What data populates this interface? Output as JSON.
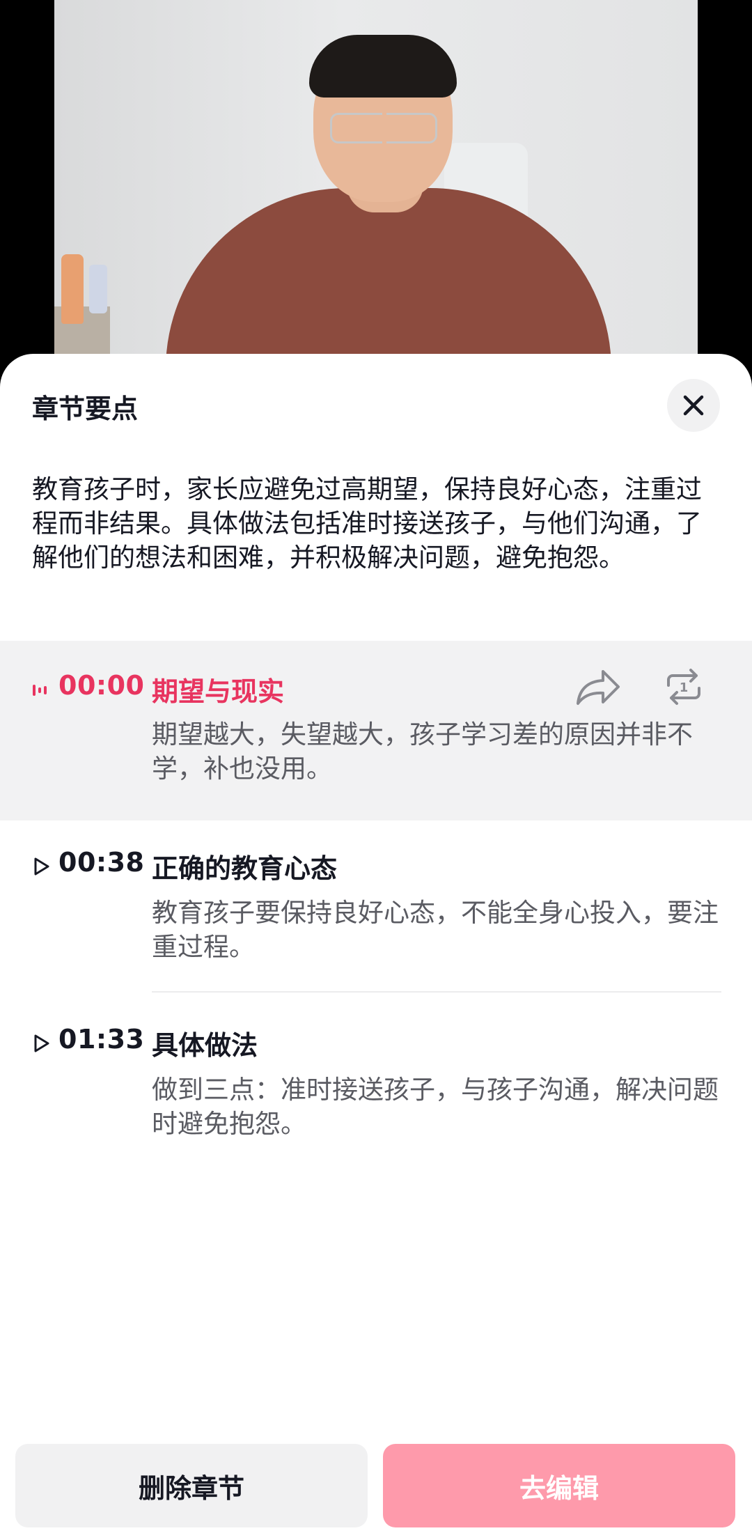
{
  "sheet": {
    "title": "章节要点",
    "close_icon": "close-icon",
    "summary": "教育孩子时，家长应避免过高期望，保持良好心态，注重过程而非结果。具体做法包括准时接送孩子，与他们沟通，了解他们的想法和困难，并积极解决问题，避免抱怨。"
  },
  "chapters": [
    {
      "time": "00:00",
      "title": "期望与现实",
      "desc": "期望越大，失望越大，孩子学习差的原因并非不学，补也没用。",
      "active": true,
      "icon": "audio-playing-icon"
    },
    {
      "time": "00:38",
      "title": "正确的教育心态",
      "desc": "教育孩子要保持良好心态，不能全身心投入，要注重过程。",
      "active": false,
      "icon": "play-icon"
    },
    {
      "time": "01:33",
      "title": "具体做法",
      "desc": "做到三点：准时接送孩子，与孩子沟通，解决问题时避免抱怨。",
      "active": false,
      "icon": "play-icon"
    }
  ],
  "chapter_actions": {
    "share_icon": "share-icon",
    "repeat_icon": "repeat-once-icon",
    "repeat_badge": "1"
  },
  "buttons": {
    "delete": "删除章节",
    "edit": "去编辑"
  },
  "colors": {
    "accent": "#e8345f",
    "edit_button": "#fe9aab"
  }
}
